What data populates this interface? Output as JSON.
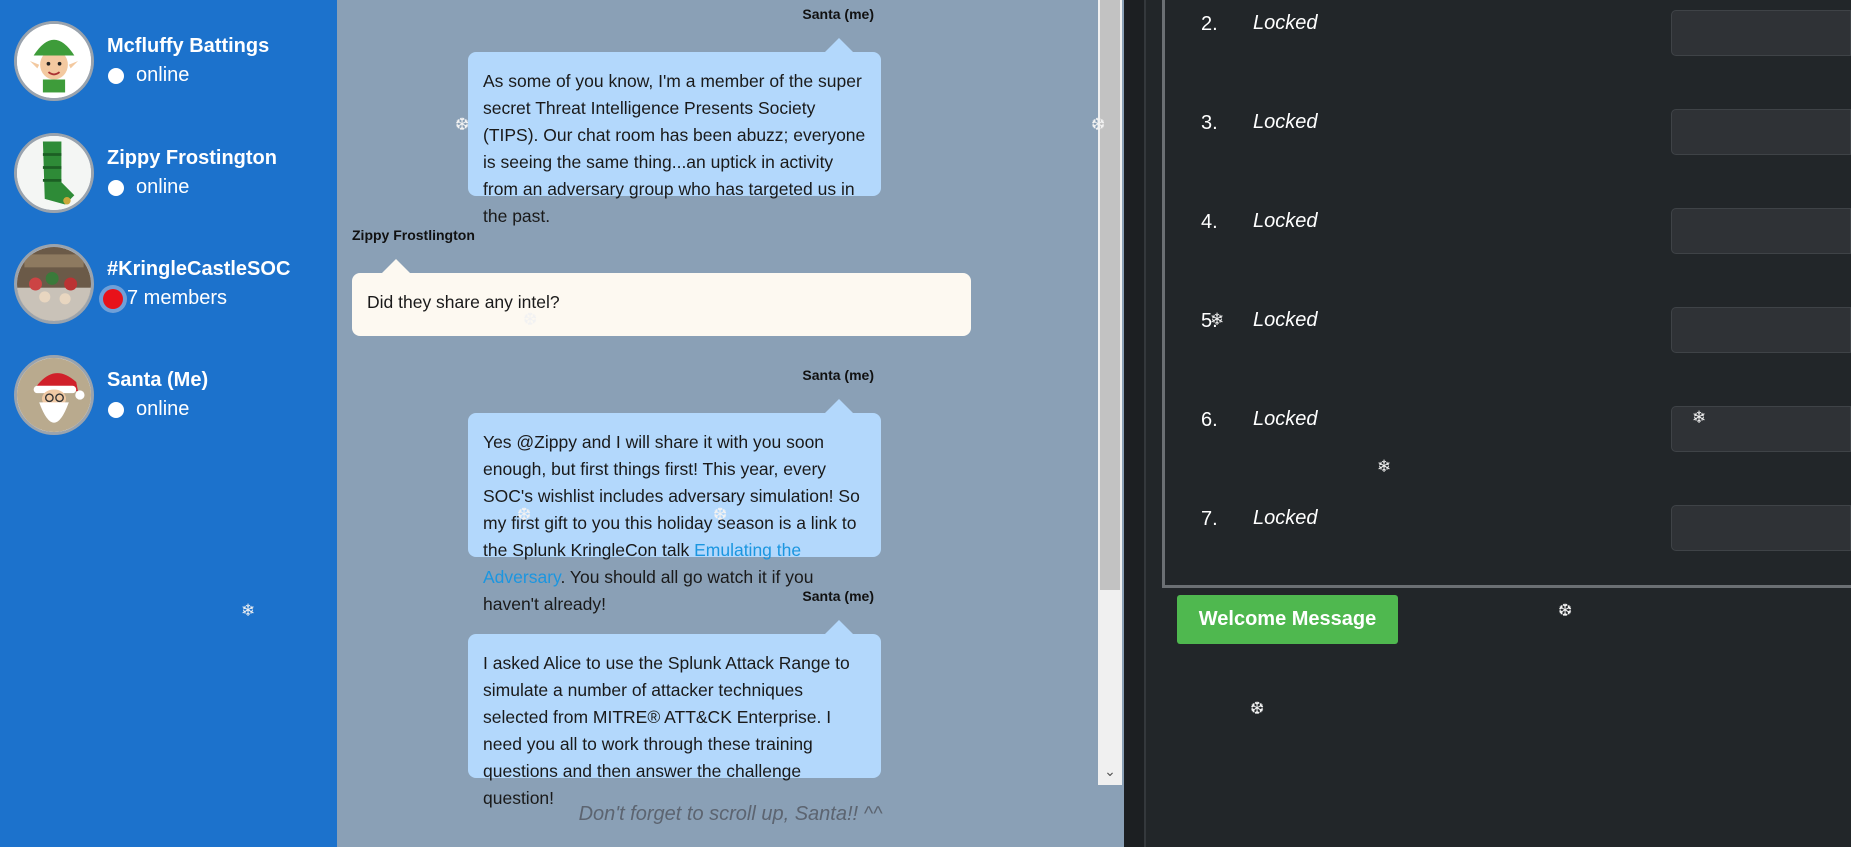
{
  "contacts": [
    {
      "name": "Mcfluffy Battings",
      "status": "online",
      "avatar_icon": "elf-avatar-icon"
    },
    {
      "name": "Zippy Frostington",
      "status": "online",
      "avatar_icon": "elf-boot-avatar-icon"
    },
    {
      "name": "#KringleCastleSOC",
      "status": "7 members",
      "avatar_icon": "group-photo-avatar-icon"
    },
    {
      "name": "Santa (Me)",
      "status": "online",
      "avatar_icon": "santa-avatar-icon"
    }
  ],
  "messages": [
    {
      "sender": "Santa (me)",
      "text": "As some of you know, I'm a member of the super secret Threat Intelligence Presents Society (TIPS). Our chat room has been abuzz; everyone is seeing the same thing...an uptick in activity from an adversary group who has targeted us in the past."
    },
    {
      "sender": "Zippy Frostlington",
      "text": "Did they share any intel?"
    },
    {
      "sender": "Santa (me)",
      "text_before": "Yes @Zippy and I will share it with you soon enough, but first things first! This year, every SOC's wishlist includes adversary simulation! So my first gift to you this holiday season is a link to the Splunk KringleCon talk ",
      "link": "Emulating the Adversary",
      "text_after": ". You should all go watch it if you haven't already!"
    },
    {
      "sender": "Santa (me)",
      "text": "I asked Alice to use the Splunk Attack Range to simulate a number of attacker techniques selected from MITRE® ATT&CK Enterprise. I need you all to work through these training questions and then answer the challenge question!"
    }
  ],
  "scroll_hint": "Don't forget to scroll up, Santa!! ^^",
  "questions": [
    {
      "num": "2.",
      "label": "Locked"
    },
    {
      "num": "3.",
      "label": "Locked"
    },
    {
      "num": "4.",
      "label": "Locked"
    },
    {
      "num": "5.",
      "label": "Locked"
    },
    {
      "num": "6.",
      "label": "Locked"
    },
    {
      "num": "7.",
      "label": "Locked"
    }
  ],
  "welcome_button": "Welcome Message",
  "colors": {
    "sidebar": "#1c72cc",
    "chat_bg": "#8aa0b6",
    "bubble_me": "#b3d8fc",
    "bubble_them": "#fdf9f1",
    "button": "#4fb84f",
    "panel": "#222629"
  }
}
